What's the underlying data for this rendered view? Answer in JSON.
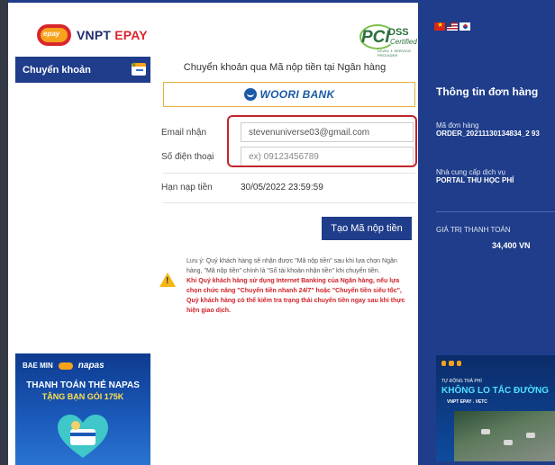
{
  "header": {
    "logo_badge": "epay",
    "logo_text_a": "VNPT ",
    "logo_text_b": "EPAY",
    "pci_word": "PCI",
    "pci_dss": "DSS",
    "pci_certified": "Certified",
    "pci_small": "LEVEL 1 SERVICE PROVIDER"
  },
  "sidebar": {
    "tab_label": "Chuyển khoản",
    "tab_icon": "card-payment-icon",
    "promo": {
      "brands_a": "BAE MIN",
      "brands_b": "napas",
      "line1": "THANH TOÁN THẺ NAPAS",
      "line2": "TẶNG BẠN GÓI 175K"
    }
  },
  "main": {
    "title": "Chuyển khoản qua Mã nộp tiền tại Ngân hàng",
    "bank_name": "WOORI BANK",
    "email_label": "Email nhận",
    "email_value": "stevenuniverse03@gmail.com",
    "phone_label": "Số điện thoại",
    "phone_placeholder": "ex) 09123456789",
    "deadline_label": "Hạn nạp tiền",
    "deadline_value": "30/05/2022 23:59:59",
    "submit_label": "Tạo Mã nộp tiền",
    "note_normal": "Lưu ý: Quý khách hàng sẽ nhận được \"Mã nộp tiền\" sau khi lựa chọn Ngân hàng, \"Mã nộp tiền\" chính là \"Số tài khoản nhận tiền\" khi chuyển tiền.",
    "note_red": "Khi Quý khách hàng sử dụng Internet Banking của Ngân hàng, nếu lựa chọn chức năng \"Chuyển tiền nhanh 24/7\" hoặc \"Chuyển tiền siêu tốc\", Quý khách hàng có thể kiểm tra trạng thái chuyển tiền ngay sau khi thực hiện giao dịch."
  },
  "order": {
    "title": "Thông tin đơn hàng",
    "order_id_label": "Mã đơn hàng",
    "order_id_value": "ORDER_20211130134834_2 93",
    "provider_label": "Nhà cung cấp dịch vụ",
    "provider_value": "PORTAL THU HỌC PHÍ",
    "amount_label": "GIÁ TRỊ THANH TOÁN",
    "amount_value": "34,400 VN",
    "banner": {
      "small": "TỰ ĐỘNG TRẢ PHÍ",
      "big": "KHÔNG LO TẮC ĐƯỜNG",
      "sub": "VNPT EPAY . VETC"
    }
  },
  "colors": {
    "primary": "#1f3d8a",
    "highlight": "#c0262d",
    "bank_border": "#e5b339",
    "note_red": "#d0242b"
  }
}
